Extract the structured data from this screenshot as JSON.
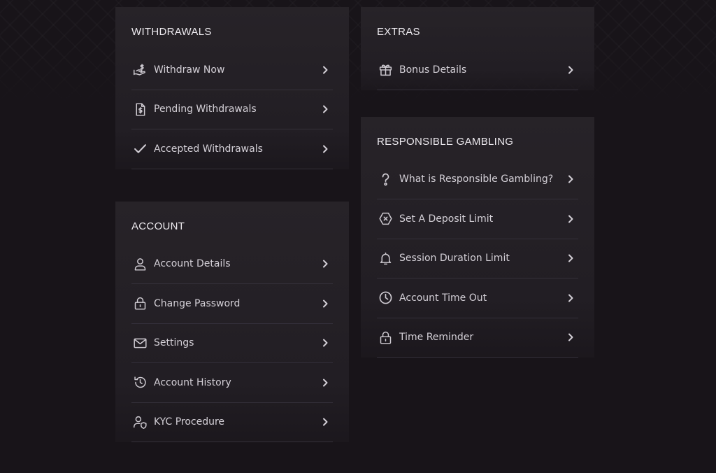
{
  "withdrawals": {
    "title": "WITHDRAWALS",
    "items": [
      {
        "label": "Withdraw Now",
        "icon": "hand-dollar-icon"
      },
      {
        "label": "Pending Withdrawals",
        "icon": "invoice-dollar-icon"
      },
      {
        "label": "Accepted Withdrawals",
        "icon": "checkmark-icon"
      }
    ]
  },
  "account": {
    "title": "ACCOUNT",
    "items": [
      {
        "label": "Account Details",
        "icon": "user-icon"
      },
      {
        "label": "Change Password",
        "icon": "lock-icon"
      },
      {
        "label": "Settings",
        "icon": "envelope-icon"
      },
      {
        "label": "Account History",
        "icon": "history-icon"
      },
      {
        "label": "KYC Procedure",
        "icon": "user-shield-icon"
      }
    ]
  },
  "extras": {
    "title": "EXTRAS",
    "items": [
      {
        "label": "Bonus Details",
        "icon": "gift-icon"
      }
    ]
  },
  "responsible": {
    "title": "RESPONSIBLE GAMBLING",
    "items": [
      {
        "label": "What is Responsible Gambling?",
        "icon": "question-icon"
      },
      {
        "label": "Set A Deposit Limit",
        "icon": "octagon-x-icon"
      },
      {
        "label": "Session Duration Limit",
        "icon": "bell-icon"
      },
      {
        "label": "Account Time Out",
        "icon": "clock-icon"
      },
      {
        "label": "Time Reminder",
        "icon": "lock-icon"
      }
    ]
  }
}
